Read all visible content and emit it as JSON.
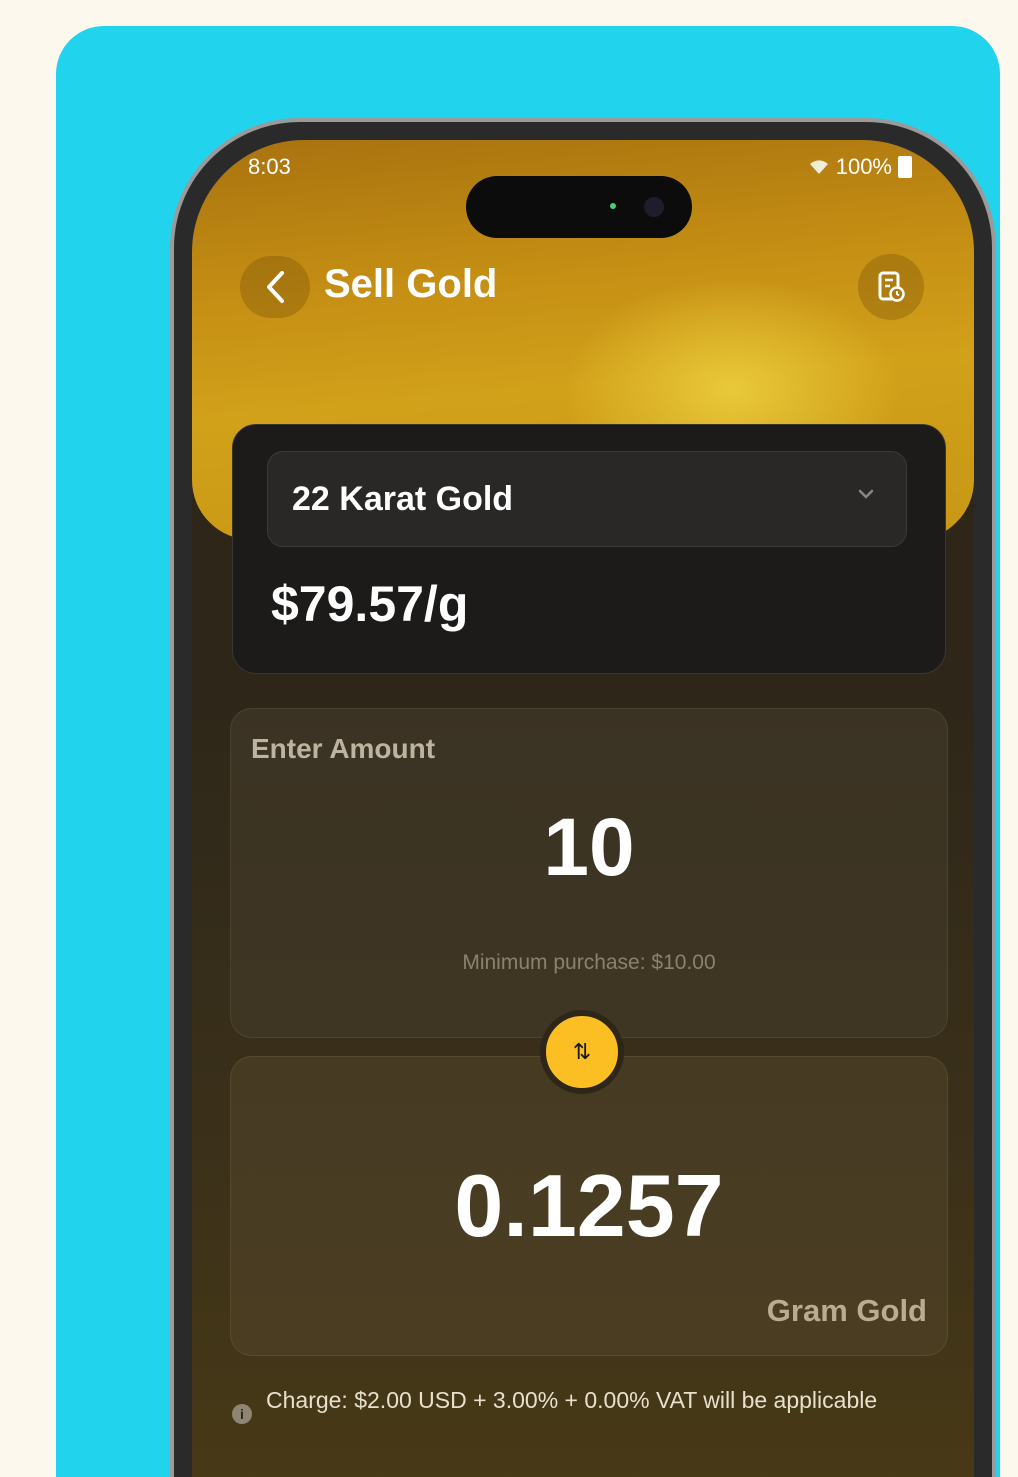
{
  "status_bar": {
    "time": "8:03",
    "signal": "📶",
    "battery": "100%"
  },
  "header": {
    "back_icon": "chevron-left-icon",
    "title": "Sell Gold",
    "history_icon": "receipt-clock-icon"
  },
  "karat_selector": {
    "selected": "22 Karat Gold",
    "price": "$79.57/g"
  },
  "amount": {
    "label": "Enter Amount",
    "value": "10",
    "minimum_note": "Minimum purchase: $10.00"
  },
  "swap": {
    "icon": "swap-vertical-icon",
    "glyph": "⇅"
  },
  "gram": {
    "value": "0.1257",
    "unit": "Gram Gold"
  },
  "charge": {
    "icon": "info-icon",
    "text": "Charge: $2.00 USD + 3.00% + 0.00% VAT will be applicable"
  },
  "colors": {
    "accent": "#fbbf24",
    "background_card": "#22d3ee",
    "gold": "#c58f14"
  }
}
